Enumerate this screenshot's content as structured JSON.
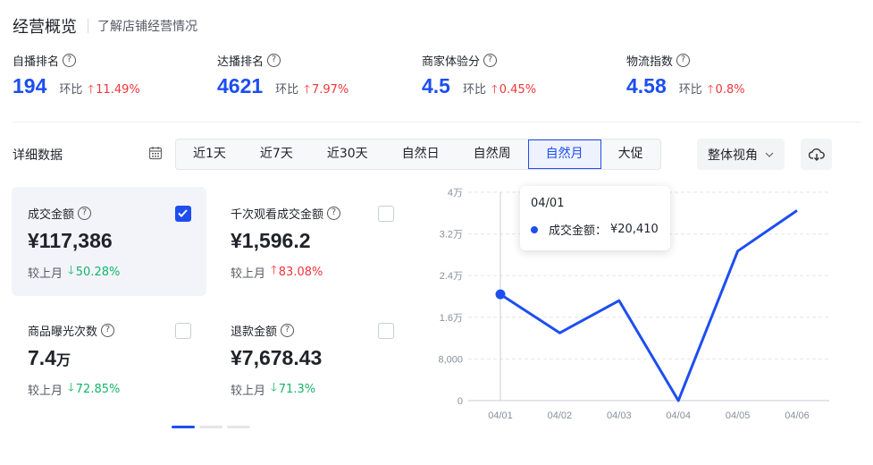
{
  "header": {
    "title": "经营概览",
    "subtitle": "了解店铺经营情况"
  },
  "metrics": [
    {
      "label": "自播排名",
      "value": "194",
      "ratio_label": "环比",
      "change": "11.49%",
      "direction": "up"
    },
    {
      "label": "达播排名",
      "value": "4621",
      "ratio_label": "环比",
      "change": "7.97%",
      "direction": "up"
    },
    {
      "label": "商家体验分",
      "value": "4.5",
      "ratio_label": "环比",
      "change": "0.45%",
      "direction": "up"
    },
    {
      "label": "物流指数",
      "value": "4.58",
      "ratio_label": "环比",
      "change": "0.8%",
      "direction": "up"
    }
  ],
  "detail": {
    "label": "详细数据",
    "tabs": [
      "近1天",
      "近7天",
      "近30天",
      "自然日",
      "自然周",
      "自然月",
      "大促"
    ],
    "active_tab": "自然月",
    "view_select": "整体视角"
  },
  "cards": [
    {
      "label": "成交金额",
      "value": "¥117,386",
      "unit": "",
      "compare_label": "较上月",
      "change": "50.28%",
      "direction": "down",
      "checked": true
    },
    {
      "label": "千次观看成交金额",
      "value": "¥1,596.2",
      "unit": "",
      "compare_label": "较上月",
      "change": "83.08%",
      "direction": "up",
      "checked": false
    },
    {
      "label": "商品曝光次数",
      "value": "7.4",
      "unit": "万",
      "compare_label": "较上月",
      "change": "72.85%",
      "direction": "down",
      "checked": false
    },
    {
      "label": "退款金额",
      "value": "¥7,678.43",
      "unit": "",
      "compare_label": "较上月",
      "change": "71.3%",
      "direction": "down",
      "checked": false
    }
  ],
  "tooltip": {
    "date": "04/01",
    "series": "成交金额：",
    "value": "¥20,410"
  },
  "colors": {
    "accent": "#1d4ef0",
    "up": "#f0353a",
    "down": "#14b56b"
  },
  "chart_data": {
    "type": "line",
    "x": [
      "04/01",
      "04/02",
      "04/03",
      "04/04",
      "04/05",
      "04/06"
    ],
    "series": [
      {
        "name": "成交金额",
        "values": [
          20410,
          13000,
          19200,
          0,
          28700,
          36500
        ]
      }
    ],
    "ylim": [
      0,
      40000
    ],
    "yticks": [
      0,
      8000,
      16000,
      24000,
      32000,
      40000
    ],
    "ytick_labels": [
      "0",
      "8,000",
      "1.6万",
      "2.4万",
      "3.2万",
      "4万"
    ],
    "grid": true,
    "highlight_index": 0
  }
}
